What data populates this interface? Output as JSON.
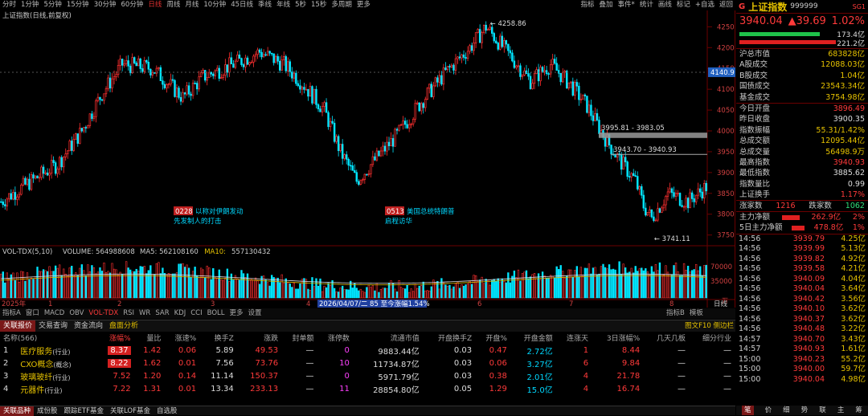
{
  "toolbar": {
    "periods": [
      "分时",
      "1分钟",
      "5分钟",
      "15分钟",
      "30分钟",
      "60分钟",
      "日线",
      "周线",
      "月线",
      "10分钟",
      "45日线",
      "季线",
      "年线",
      "5秒",
      "15秒",
      "多周期",
      "更多"
    ],
    "active_index": 6,
    "right": [
      "指标",
      "叠加",
      "事件*",
      "统计",
      "画线",
      "标记",
      "+自选",
      "返回"
    ]
  },
  "chart": {
    "title": "上证指数(日线,前复权)",
    "price_ticks": [
      "4250",
      "4200",
      "4150",
      "4100",
      "4050",
      "4000",
      "3950",
      "3900",
      "3850",
      "3800",
      "3750"
    ],
    "current_price_tag": "4140.9",
    "high_label": "4258.86",
    "low_label": "3741.11",
    "box1_label": "3995.81 - 3983.05",
    "box2_label": "3943.70 - 3940.93",
    "news1_date": "0228",
    "news1_line1": "以称对伊朗发动",
    "news1_line2": "先发制人的打击",
    "news2_date": "0513",
    "news2_line1": "美国总统特朗普",
    "news2_line2": "启程访华"
  },
  "volume": {
    "header_name": "VOL-TDX(5,10)",
    "vol_label": "VOLUME:",
    "vol": "564988608",
    "ma5_label": "MA5:",
    "ma5": "562108160",
    "ma10_label": "MA10:",
    "ma10": "557130432",
    "ticks": [
      "70000",
      "35000"
    ],
    "unit": "万"
  },
  "xaxis": {
    "year": "2025年",
    "months": [
      "1",
      "2",
      "3",
      "4",
      "5",
      "6",
      "7",
      "8"
    ],
    "cursor_info": "2026/04/07/二 85 至今涨幅1.54%",
    "period_label": "日线"
  },
  "indicators": {
    "items": [
      "指标A",
      "窗口",
      "MACD",
      "OBV",
      "VOL-TDX",
      "RSI",
      "WR",
      "SAR",
      "KDJ",
      "CCI",
      "BOLL",
      "更多",
      "设置"
    ],
    "active": "VOL-TDX",
    "right": [
      "指标B",
      "模板"
    ]
  },
  "tabs": {
    "items": [
      "关联报价",
      "交易查询",
      "资金流向",
      "盘面分析"
    ],
    "right": "图文F10",
    "right2": "侧边栏"
  },
  "table": {
    "headers": [
      "名称(566)",
      "涨幅%",
      "量比",
      "涨速%",
      "换手Z",
      "涨跌",
      "封单额",
      "涨停数",
      "流通市值",
      "开盘换手Z",
      "开盘%",
      "开盘金额",
      "连涨天",
      "3日涨幅%",
      "几天几板",
      "细分行业"
    ],
    "rows": [
      {
        "idx": "1",
        "name": "医疗服务",
        "tag": "(行业)",
        "chg": "8.37",
        "vr": "1.42",
        "spd": "0.06",
        "turn": "5.89",
        "diff": "49.53",
        "seal": "—",
        "lim": "0",
        "mcap": "9883.44亿",
        "oturn": "0.03",
        "open": "0.47",
        "oamt": "2.72亿",
        "days": "1",
        "chg3": "8.44",
        "board": "—",
        "sub": "—"
      },
      {
        "idx": "2",
        "name": "CXO概念",
        "tag": "(概念)",
        "chg": "8.22",
        "vr": "1.62",
        "spd": "0.01",
        "turn": "7.56",
        "diff": "73.76",
        "seal": "—",
        "lim": "10",
        "mcap": "11734.87亿",
        "oturn": "0.03",
        "open": "0.06",
        "oamt": "3.27亿",
        "days": "6",
        "chg3": "9.84",
        "board": "—",
        "sub": "—"
      },
      {
        "idx": "3",
        "name": "玻璃玻纤",
        "tag": "(行业)",
        "chg": "7.52",
        "vr": "1.20",
        "spd": "0.14",
        "turn": "11.14",
        "diff": "150.37",
        "seal": "—",
        "lim": "0",
        "mcap": "5971.79亿",
        "oturn": "0.03",
        "open": "0.38",
        "oamt": "2.01亿",
        "days": "4",
        "chg3": "21.78",
        "board": "—",
        "sub": "—"
      },
      {
        "idx": "4",
        "name": "元器件",
        "tag": "(行业)",
        "chg": "7.22",
        "vr": "1.31",
        "spd": "0.01",
        "turn": "13.34",
        "diff": "233.13",
        "seal": "—",
        "lim": "11",
        "mcap": "28854.80亿",
        "oturn": "0.05",
        "open": "1.29",
        "oamt": "15.0亿",
        "days": "4",
        "chg3": "16.74",
        "board": "—",
        "sub": "—"
      }
    ]
  },
  "bottom_tabs": [
    "关联品种",
    "成份股",
    "跟踪ETF基金",
    "关联LOF基金",
    "自选股"
  ],
  "right_panel": {
    "badge": "G",
    "name": "上证指数",
    "code": "999999",
    "tag": "SG1",
    "price": "3940.04",
    "change": "▲39.69",
    "pct": "1.02%",
    "bar1": "173.4亿",
    "bar2": "221.2亿",
    "stats1": [
      [
        "沪总市值",
        "683828亿"
      ],
      [
        "A股成交",
        "12088.03亿"
      ],
      [
        "B股成交",
        "1.04亿"
      ],
      [
        "国债成交",
        "23543.34亿"
      ],
      [
        "基金成交",
        "3754.98亿"
      ]
    ],
    "stats2": [
      [
        "今日开盘",
        "3896.49"
      ],
      [
        "昨日收盘",
        "3900.35"
      ],
      [
        "指数振幅",
        "55.31/1.42%"
      ],
      [
        "总成交额",
        "12095.44亿"
      ],
      [
        "总成交量",
        "56498.9万"
      ],
      [
        "最高指数",
        "3940.93"
      ],
      [
        "最低指数",
        "3885.62"
      ],
      [
        "指数量比",
        "0.99"
      ],
      [
        "上证换手",
        "1.17%"
      ]
    ],
    "up_label": "涨家数",
    "up": "1216",
    "down_label": "跌家数",
    "down": "1062",
    "flow1_label": "主力净额",
    "flow1": "262.9亿",
    "flow1_pct": "2%",
    "flow2_label": "5日主力净额",
    "flow2": "478.8亿",
    "flow2_pct": "1%",
    "ticks": [
      [
        "14:56",
        "3939.79",
        "4.25亿"
      ],
      [
        "14:56",
        "3939.99",
        "5.13亿"
      ],
      [
        "14:56",
        "3939.82",
        "4.92亿"
      ],
      [
        "14:56",
        "3939.58",
        "4.21亿"
      ],
      [
        "14:56",
        "3940.09",
        "4.04亿"
      ],
      [
        "14:56",
        "3940.04",
        "3.64亿"
      ],
      [
        "14:56",
        "3940.42",
        "3.56亿"
      ],
      [
        "14:56",
        "3940.10",
        "3.62亿"
      ],
      [
        "14:56",
        "3940.37",
        "3.62亿"
      ],
      [
        "14:56",
        "3940.48",
        "3.22亿"
      ],
      [
        "14:57",
        "3940.70",
        "3.43亿"
      ],
      [
        "14:57",
        "3940.93",
        "1.61亿"
      ],
      [
        "15:00",
        "3940.23",
        "55.2亿"
      ],
      [
        "15:00",
        "3940.00",
        "59.7亿"
      ],
      [
        "15:00",
        "3940.04",
        "4.98亿"
      ]
    ],
    "bottom": [
      "笔",
      "价",
      "细",
      "势",
      "联",
      "主",
      "筹"
    ]
  }
}
